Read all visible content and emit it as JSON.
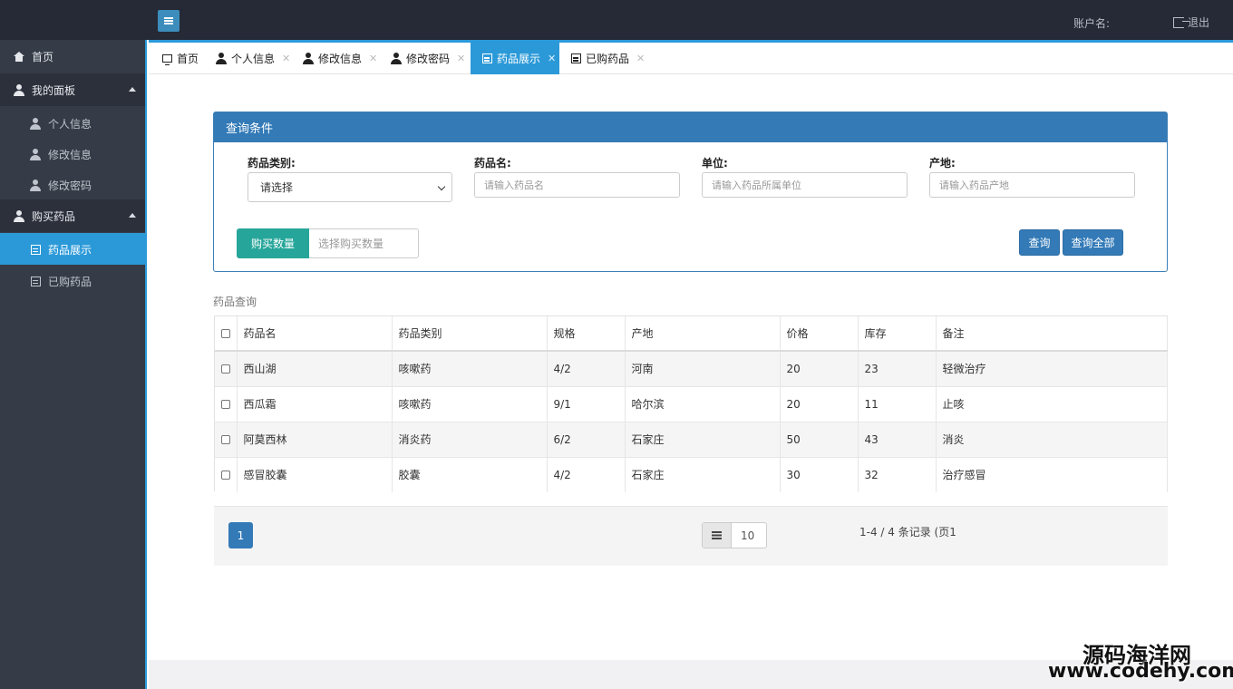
{
  "header": {
    "account_label": "账户名:",
    "logout_label": "退出"
  },
  "sidebar": {
    "items": [
      {
        "label": "首页"
      },
      {
        "label": "我的面板"
      },
      {
        "label": "个人信息"
      },
      {
        "label": "修改信息"
      },
      {
        "label": "修改密码"
      },
      {
        "label": "购买药品"
      },
      {
        "label": "药品展示"
      },
      {
        "label": "已购药品"
      }
    ]
  },
  "tabs": [
    {
      "label": "首页"
    },
    {
      "label": "个人信息"
    },
    {
      "label": "修改信息"
    },
    {
      "label": "修改密码"
    },
    {
      "label": "药品展示"
    },
    {
      "label": "已购药品"
    }
  ],
  "query": {
    "title": "查询条件",
    "category_label": "药品类别:",
    "category_value": "请选择",
    "name_label": "药品名:",
    "name_placeholder": "请输入药品名",
    "unit_label": "单位:",
    "unit_placeholder": "请输入药品所属单位",
    "origin_label": "产地:",
    "origin_placeholder": "请输入药品产地",
    "qty_label": "购买数量",
    "qty_placeholder": "选择购买数量",
    "search_button": "查询",
    "search_all_button": "查询全部"
  },
  "results": {
    "section_title": "药品查询",
    "columns": [
      "药品名",
      "药品类别",
      "规格",
      "产地",
      "价格",
      "库存",
      "备注"
    ],
    "rows": [
      [
        "西山湖",
        "咳嗽药",
        "4/2",
        "河南",
        "20",
        "23",
        "轻微治疗"
      ],
      [
        "西瓜霜",
        "咳嗽药",
        "9/1",
        "哈尔滨",
        "20",
        "11",
        "止咳"
      ],
      [
        "阿莫西林",
        "消炎药",
        "6/2",
        "石家庄",
        "50",
        "43",
        "消炎"
      ],
      [
        "感冒胶囊",
        "胶囊",
        "4/2",
        "石家庄",
        "30",
        "32",
        "治疗感冒"
      ]
    ]
  },
  "pager": {
    "current_page": "1",
    "page_size": "10",
    "records_text": "1-4 / 4 条记录 (页1"
  },
  "watermark": {
    "line1": "源码海洋网",
    "line2": "www.codehy.com"
  },
  "colors": {
    "primary": "#337ab7",
    "accent": "#2b99d8",
    "teal": "#26a69a",
    "sidebar_bg": "#353b47",
    "topbar_bg": "#252a36"
  }
}
